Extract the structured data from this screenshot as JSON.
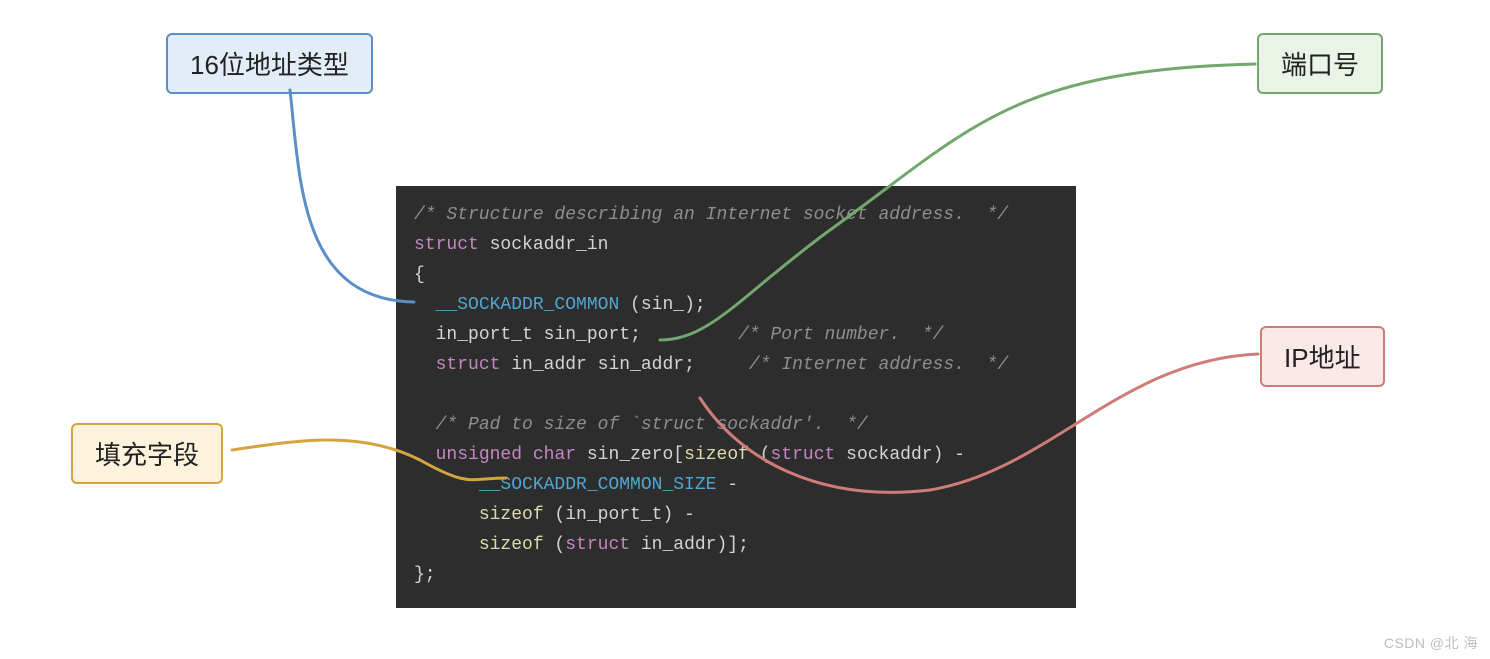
{
  "callouts": {
    "addr_type": "16位地址类型",
    "port": "端口号",
    "fill": "填充字段",
    "ip": "IP地址"
  },
  "code": {
    "c1": "/* Structure describing an Internet socket address.  */",
    "kw_struct": "struct",
    "sockaddr_in": "sockaddr_in",
    "brace_open": "{",
    "macro_common": "__SOCKADDR_COMMON",
    "common_arg_open": " (",
    "common_arg": "sin_",
    "common_arg_close": ");",
    "in_port_t": "in_port_t",
    "sin_port": "sin_port",
    "semi": ";",
    "c_port": "/* Port number.  */",
    "in_addr": "in_addr",
    "sin_addr": "sin_addr",
    "c_addr": "/* Internet address.  */",
    "c_pad": "/* Pad to size of `struct sockaddr'.  */",
    "unsigned": "unsigned",
    "char": "char",
    "sin_zero": "sin_zero",
    "lbrack": "[",
    "sizeof": "sizeof",
    "lpar": " (",
    "sockaddr": "sockaddr",
    "rpar_minus": ") -",
    "macro_size": "__SOCKADDR_COMMON_SIZE",
    "minus": " -",
    "rpar_rbrack": ")];",
    "brace_close": "};"
  },
  "colors": {
    "bg": "#2d2d2d",
    "comment": "#8e8e8e",
    "keyword": "#c586c0",
    "macro": "#4fa6d3",
    "func": "#dcdcaa",
    "text": "#d4d4d4",
    "blue": "#5a8fc7",
    "green": "#72a86d",
    "orange": "#d6a43e",
    "red": "#cf7c78"
  },
  "watermark": "CSDN @北  海"
}
